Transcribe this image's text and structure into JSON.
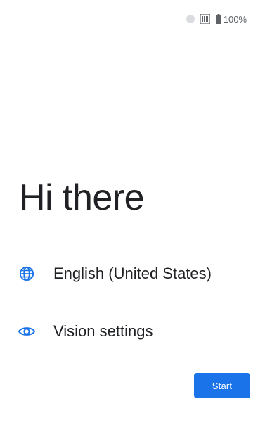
{
  "status_bar": {
    "battery_text": "100%",
    "icons": [
      "circle-indicator",
      "barcode-scanner-icon",
      "battery-icon"
    ]
  },
  "welcome": {
    "title": "Hi there"
  },
  "options": [
    {
      "icon": "globe-icon",
      "label": "English (United States)"
    },
    {
      "icon": "eye-icon",
      "label": "Vision settings"
    }
  ],
  "start_button": {
    "label": "Start"
  },
  "colors": {
    "accent": "#1a73e8",
    "text": "#202124",
    "status_icon": "#5f6368",
    "background": "#ffffff"
  }
}
